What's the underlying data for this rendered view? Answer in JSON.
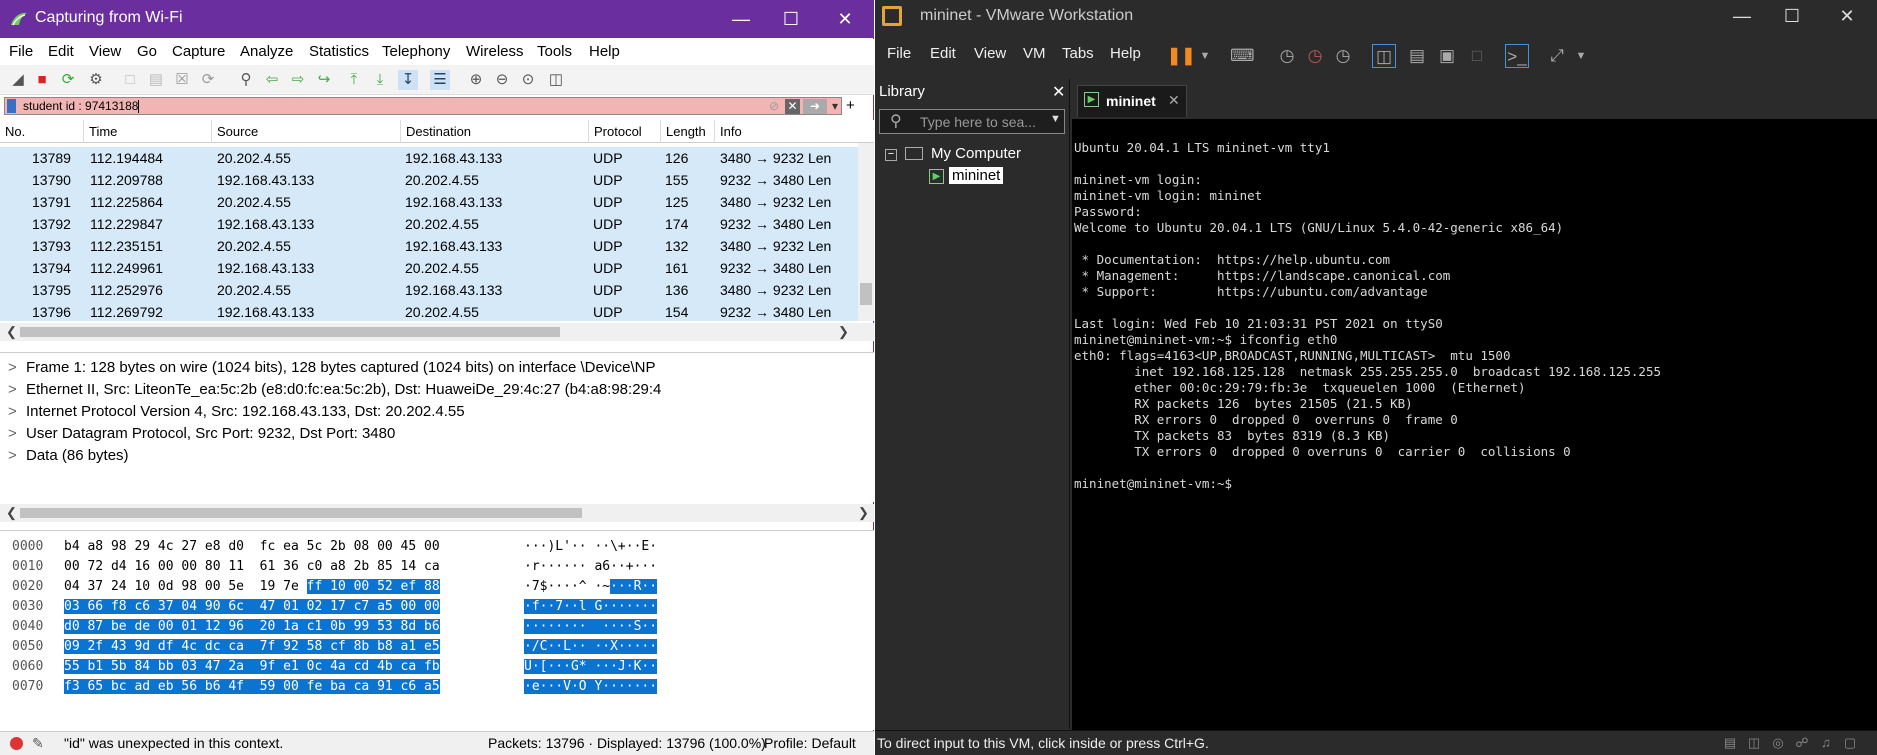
{
  "wireshark": {
    "title": "Capturing from Wi-Fi",
    "menu": [
      "File",
      "Edit",
      "View",
      "Go",
      "Capture",
      "Analyze",
      "Statistics",
      "Telephony",
      "Wireless",
      "Tools",
      "Help"
    ],
    "filter": {
      "value": "student id : 97413188"
    },
    "columns": [
      "No.",
      "Time",
      "Source",
      "Destination",
      "Protocol",
      "Length",
      "Info"
    ],
    "packets": [
      {
        "no": "13789",
        "time": "112.194484",
        "src": "20.202.4.55",
        "dst": "192.168.43.133",
        "proto": "UDP",
        "len": "126",
        "info": "3480 → 9232 Len"
      },
      {
        "no": "13790",
        "time": "112.209788",
        "src": "192.168.43.133",
        "dst": "20.202.4.55",
        "proto": "UDP",
        "len": "155",
        "info": "9232 → 3480 Len"
      },
      {
        "no": "13791",
        "time": "112.225864",
        "src": "20.202.4.55",
        "dst": "192.168.43.133",
        "proto": "UDP",
        "len": "125",
        "info": "3480 → 9232 Len"
      },
      {
        "no": "13792",
        "time": "112.229847",
        "src": "192.168.43.133",
        "dst": "20.202.4.55",
        "proto": "UDP",
        "len": "174",
        "info": "9232 → 3480 Len"
      },
      {
        "no": "13793",
        "time": "112.235151",
        "src": "20.202.4.55",
        "dst": "192.168.43.133",
        "proto": "UDP",
        "len": "132",
        "info": "3480 → 9232 Len"
      },
      {
        "no": "13794",
        "time": "112.249961",
        "src": "192.168.43.133",
        "dst": "20.202.4.55",
        "proto": "UDP",
        "len": "161",
        "info": "9232 → 3480 Len"
      },
      {
        "no": "13795",
        "time": "112.252976",
        "src": "20.202.4.55",
        "dst": "192.168.43.133",
        "proto": "UDP",
        "len": "136",
        "info": "3480 → 9232 Len"
      },
      {
        "no": "13796",
        "time": "112.269792",
        "src": "192.168.43.133",
        "dst": "20.202.4.55",
        "proto": "UDP",
        "len": "154",
        "info": "9232 → 3480 Len"
      }
    ],
    "details": [
      "Frame 1: 128 bytes on wire (1024 bits), 128 bytes captured (1024 bits) on interface \\Device\\NP",
      "Ethernet II, Src: LiteonTe_ea:5c:2b (e8:d0:fc:ea:5c:2b), Dst: HuaweiDe_29:4c:27 (b4:a8:98:29:4",
      "Internet Protocol Version 4, Src: 192.168.43.133, Dst: 20.202.4.55",
      "User Datagram Protocol, Src Port: 9232, Dst Port: 3480",
      "Data (86 bytes)"
    ],
    "hex": [
      {
        "off": "0000",
        "pre": "b4 a8 98 29 4c 27 e8 d0  fc ea 5c 2b 08 00 45 00",
        "hl": "",
        "apre": "···)L'·· ··\\+··E·",
        "ahl": ""
      },
      {
        "off": "0010",
        "pre": "00 72 d4 16 00 00 80 11  61 36 c0 a8 2b 85 14 ca",
        "hl": "",
        "apre": "·r······ a6··+···",
        "ahl": ""
      },
      {
        "off": "0020",
        "pre": "04 37 24 10 0d 98 00 5e  19 7e ",
        "hl": "ff 10 00 52 ef 88",
        "apre": "·7$····^ ·~",
        "ahl": "···R··"
      },
      {
        "off": "0030",
        "pre": "",
        "hl": "03 66 f8 c6 37 04 90 6c  47 01 02 17 c7 a5 00 00",
        "apre": "",
        "ahl": "·f··7··l G·······"
      },
      {
        "off": "0040",
        "pre": "",
        "hl": "d0 87 be de 00 01 12 96  20 1a c1 0b 99 53 8d b6",
        "apre": "",
        "ahl": "········  ····S··"
      },
      {
        "off": "0050",
        "pre": "",
        "hl": "09 2f 43 9d df 4c dc ca  7f 92 58 cf 8b b8 a1 e5",
        "apre": "",
        "ahl": "·/C··L·· ··X·····"
      },
      {
        "off": "0060",
        "pre": "",
        "hl": "55 b1 5b 84 bb 03 47 2a  9f e1 0c 4a cd 4b ca fb",
        "apre": "",
        "ahl": "U·[···G* ···J·K··"
      },
      {
        "off": "0070",
        "pre": "",
        "hl": "f3 65 bc ad eb 56 b6 4f  59 00 fe ba ca 91 c6 a5",
        "apre": "",
        "ahl": "·e···V·O Y·······"
      }
    ],
    "status": {
      "message": "\"id\" was unexpected in this context.",
      "packets": "Packets: 13796 · Displayed: 13796 (100.0%)",
      "profile": "Profile: Default"
    }
  },
  "vmware": {
    "title": "mininet - VMware Workstation",
    "menu": [
      "File",
      "Edit",
      "View",
      "VM",
      "Tabs",
      "Help"
    ],
    "library": {
      "title": "Library",
      "search_placeholder": "Type here to sea...",
      "root": "My Computer",
      "vm": "mininet"
    },
    "tab": "mininet",
    "console": [
      "Ubuntu 20.04.1 LTS mininet-vm tty1",
      "",
      "mininet-vm login:",
      "mininet-vm login: mininet",
      "Password:",
      "Welcome to Ubuntu 20.04.1 LTS (GNU/Linux 5.4.0-42-generic x86_64)",
      "",
      " * Documentation:  https://help.ubuntu.com",
      " * Management:     https://landscape.canonical.com",
      " * Support:        https://ubuntu.com/advantage",
      "",
      "Last login: Wed Feb 10 21:03:31 PST 2021 on ttyS0",
      "mininet@mininet-vm:~$ ifconfig eth0",
      "eth0: flags=4163<UP,BROADCAST,RUNNING,MULTICAST>  mtu 1500",
      "        inet 192.168.125.128  netmask 255.255.255.0  broadcast 192.168.125.255",
      "        ether 00:0c:29:79:fb:3e  txqueuelen 1000  (Ethernet)",
      "        RX packets 126  bytes 21505 (21.5 KB)",
      "        RX errors 0  dropped 0  overruns 0  frame 0",
      "        TX packets 83  bytes 8319 (8.3 KB)",
      "        TX errors 0  dropped 0 overruns 0  carrier 0  collisions 0",
      "",
      "mininet@mininet-vm:~$"
    ],
    "status": "To direct input to this VM, click inside or press Ctrl+G."
  }
}
